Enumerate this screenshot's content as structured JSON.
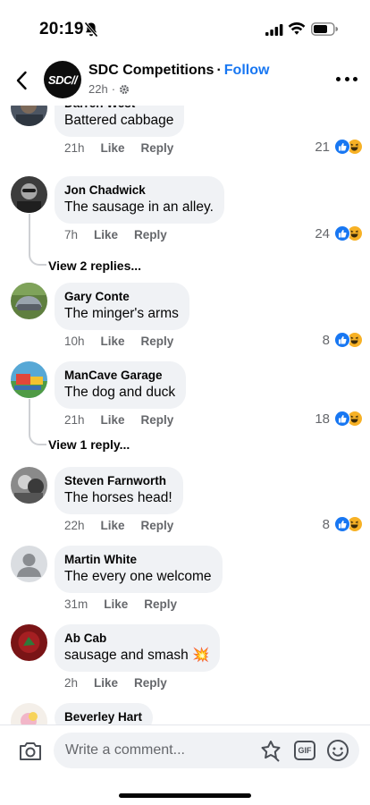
{
  "status_bar": {
    "time": "20:19"
  },
  "header": {
    "page_name": "SDC Competitions",
    "separator": "·",
    "follow_label": "Follow",
    "post_age": "22h",
    "avatar_text": "SDC"
  },
  "comments": [
    {
      "author": "Darren West",
      "text": "Battered cabbage",
      "time": "21h",
      "like_label": "Like",
      "reply_label": "Reply",
      "reaction_count": "21"
    },
    {
      "author": "Jon Chadwick",
      "text": "The sausage in an alley.",
      "time": "7h",
      "like_label": "Like",
      "reply_label": "Reply",
      "reaction_count": "24",
      "view_replies": "View 2 replies..."
    },
    {
      "author": "Gary Conte",
      "text": "The minger's arms",
      "time": "10h",
      "like_label": "Like",
      "reply_label": "Reply",
      "reaction_count": "8"
    },
    {
      "author": "ManCave Garage",
      "text": "The dog and duck",
      "time": "21h",
      "like_label": "Like",
      "reply_label": "Reply",
      "reaction_count": "18",
      "view_replies": "View 1 reply..."
    },
    {
      "author": "Steven Farnworth",
      "text": "The horses head!",
      "time": "22h",
      "like_label": "Like",
      "reply_label": "Reply",
      "reaction_count": "8"
    },
    {
      "author": "Martin White",
      "text": "The every one welcome",
      "time": "31m",
      "like_label": "Like",
      "reply_label": "Reply"
    },
    {
      "author": "Ab Cab",
      "text": "sausage and smash 💥",
      "time": "2h",
      "like_label": "Like",
      "reply_label": "Reply"
    },
    {
      "author": "Beverley Hart"
    }
  ],
  "composer": {
    "placeholder": "Write a comment...",
    "gif_label": "GIF"
  },
  "colors": {
    "accent": "#1877f2",
    "bubble": "#f0f2f5",
    "secondary_text": "#65676b",
    "haha": "#f7b125"
  }
}
